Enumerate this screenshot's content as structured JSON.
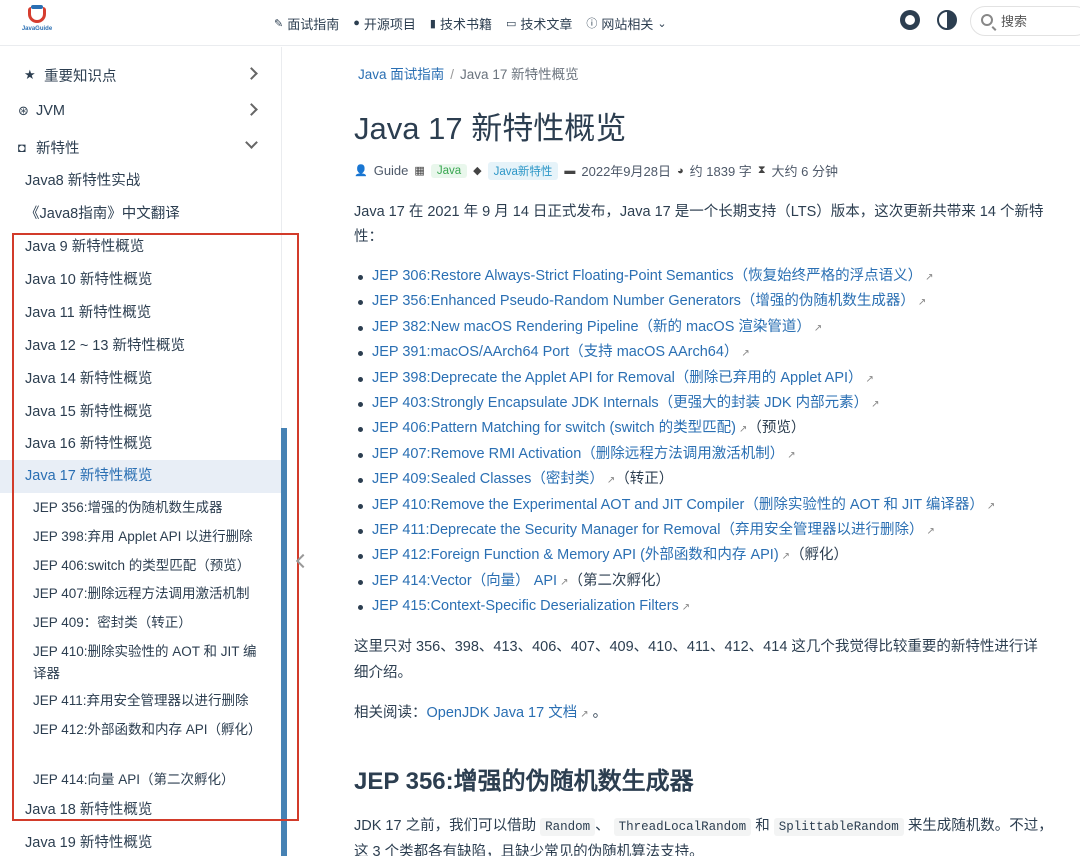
{
  "navbar": {
    "logo_text": "JavaGuide",
    "links": [
      {
        "icon": "pen-icon",
        "label": "面试指南"
      },
      {
        "icon": "github-icon",
        "label": "开源项目"
      },
      {
        "icon": "book-icon",
        "label": "技术书籍"
      },
      {
        "icon": "article-icon",
        "label": "技术文章"
      },
      {
        "icon": "info-icon",
        "label": "网站相关"
      }
    ],
    "search_placeholder": "搜索"
  },
  "sidebar": {
    "groups": [
      {
        "icon": "star-icon",
        "label": "重要知识点",
        "expanded": false
      },
      {
        "icon": "jvm-icon",
        "label": "JVM",
        "expanded": false
      },
      {
        "icon": "bookmark-icon",
        "label": "新特性",
        "expanded": true
      }
    ],
    "items": [
      "Java8 新特性实战",
      "《Java8指南》中文翻译",
      "Java 9 新特性概览",
      "Java 10 新特性概览",
      "Java 11 新特性概览",
      "Java 12 ~ 13 新特性概览",
      "Java 14 新特性概览",
      "Java 15 新特性概览",
      "Java 16 新特性概览",
      "Java 17 新特性概览"
    ],
    "sub_items": [
      "JEP 356:增强的伪随机数生成器",
      "JEP 398:弃用 Applet API 以进行删除",
      "JEP 406:switch 的类型匹配（预览）",
      "JEP 407:删除远程方法调用激活机制",
      "JEP 409：密封类（转正）",
      "JEP 410:删除实验性的 AOT 和 JIT 编译器",
      "JEP 411:弃用安全管理器以进行删除",
      "JEP 412:外部函数和内存 API（孵化）",
      "JEP 414:向量 API（第二次孵化）"
    ],
    "after_items": [
      "Java 18 新特性概览",
      "Java 19 新特性概览"
    ]
  },
  "breadcrumb": {
    "parent": "Java 面试指南",
    "current": "Java 17 新特性概览"
  },
  "article": {
    "title": "Java 17 新特性概览",
    "meta": {
      "author": "Guide",
      "category": "Java",
      "tag": "Java新特性",
      "date": "2022年9月28日",
      "words": "约 1839 字",
      "read_time": "大约 6 分钟"
    },
    "intro_line1": "Java 17 在 2021 年 9 月 14 日正式发布，Java 17 是一个长期支持（LTS）版本，这次更新共带来 14 个新特",
    "intro_line2": "性：",
    "jeps": [
      {
        "text": "JEP 306:Restore Always-Strict Floating-Point Semantics（恢复始终严格的浮点语义）",
        "suffix": ""
      },
      {
        "text": "JEP 356:Enhanced Pseudo-Random Number Generators（增强的伪随机数生成器）",
        "suffix": ""
      },
      {
        "text": "JEP 382:New macOS Rendering Pipeline（新的 macOS 渲染管道）",
        "suffix": ""
      },
      {
        "text": "JEP 391:macOS/AArch64 Port（支持 macOS AArch64）",
        "suffix": ""
      },
      {
        "text": "JEP 398:Deprecate the Applet API for Removal（删除已弃用的 Applet API）",
        "suffix": ""
      },
      {
        "text": "JEP 403:Strongly Encapsulate JDK Internals（更强大的封装 JDK 内部元素）",
        "suffix": ""
      },
      {
        "text": "JEP 406:Pattern Matching for switch (switch 的类型匹配)",
        "suffix": "（预览）"
      },
      {
        "text": "JEP 407:Remove RMI Activation（删除远程方法调用激活机制）",
        "suffix": ""
      },
      {
        "text": "JEP 409:Sealed Classes（密封类）",
        "suffix": "（转正）"
      },
      {
        "text": "JEP 410:Remove the Experimental AOT and JIT Compiler（删除实验性的 AOT 和 JIT 编译器）",
        "suffix": ""
      },
      {
        "text": "JEP 411:Deprecate the Security Manager for Removal（弃用安全管理器以进行删除）",
        "suffix": ""
      },
      {
        "text": "JEP 412:Foreign Function & Memory API (外部函数和内存 API)",
        "suffix": "（孵化）"
      },
      {
        "text": "JEP 414:Vector（向量） API",
        "suffix": "（第二次孵化）"
      },
      {
        "text": "JEP 415:Context-Specific Deserialization Filters",
        "suffix": ""
      }
    ],
    "para2_line1": "这里只对 356、398、413、406、407、409、410、411、412、414 这几个我觉得比较重要的新特性进行详",
    "para2_line2": "细介绍。",
    "related_label": "相关阅读：",
    "related_link": "OpenJDK Java 17 文档",
    "related_end": " 。",
    "h2": "JEP 356:增强的伪随机数生成器",
    "last_para": {
      "prefix": "JDK 17 之前，我们可以借助",
      "code1": "Random",
      "sep1": "、",
      "code2": "ThreadLocalRandom",
      "sep2": "和",
      "code3": "SplittableRandom",
      "suffix": "来生成随机数。不过，",
      "line2": "这 3 个类都各有缺陷，且缺少常见的伪随机算法支持。"
    }
  }
}
